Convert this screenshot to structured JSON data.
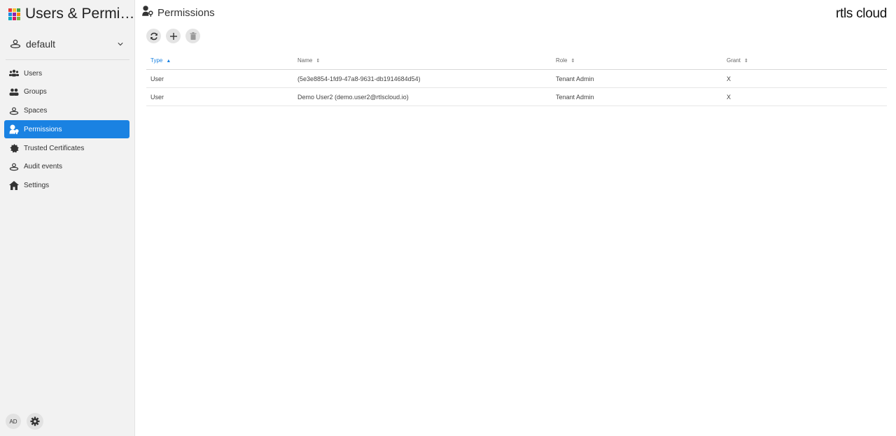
{
  "app": {
    "title": "Users & Permi…",
    "grid_colors": [
      "#e53935",
      "#fbc02d",
      "#43a047",
      "#1e88e5",
      "#8e24aa",
      "#fb8c00",
      "#00acc1",
      "#d81b60",
      "#7cb342"
    ]
  },
  "space_selector": {
    "value": "default"
  },
  "sidebar": {
    "items": [
      {
        "label": "Users",
        "icon": "users-icon"
      },
      {
        "label": "Groups",
        "icon": "groups-icon"
      },
      {
        "label": "Spaces",
        "icon": "spaces-icon"
      },
      {
        "label": "Permissions",
        "icon": "permissions-icon",
        "active": true
      },
      {
        "label": "Trusted Certificates",
        "icon": "certificate-icon"
      },
      {
        "label": "Audit events",
        "icon": "audit-icon"
      },
      {
        "label": "Settings",
        "icon": "home-icon"
      }
    ],
    "footer": {
      "avatar": "AD"
    }
  },
  "page": {
    "title": "Permissions",
    "brand": "rtls cloud"
  },
  "toolbar": [
    "refresh-icon",
    "add-icon",
    "delete-icon"
  ],
  "table": {
    "columns": [
      {
        "label": "Type",
        "sort": "▲"
      },
      {
        "label": "Name",
        "sort": "⇕"
      },
      {
        "label": "Role",
        "sort": "⇕"
      },
      {
        "label": "Grant",
        "sort": "⇕"
      }
    ],
    "rows": [
      [
        "User",
        "(5e3e8854-1fd9-47a8-9631-db1914684d54)",
        "Tenant Admin",
        "X"
      ],
      [
        "User",
        "Demo User2 (demo.user2@rtlscloud.io)",
        "Tenant Admin",
        "X"
      ]
    ]
  },
  "colors": {
    "accent": "#1a82e2",
    "sidebar_bg": "#f2f2f2"
  }
}
